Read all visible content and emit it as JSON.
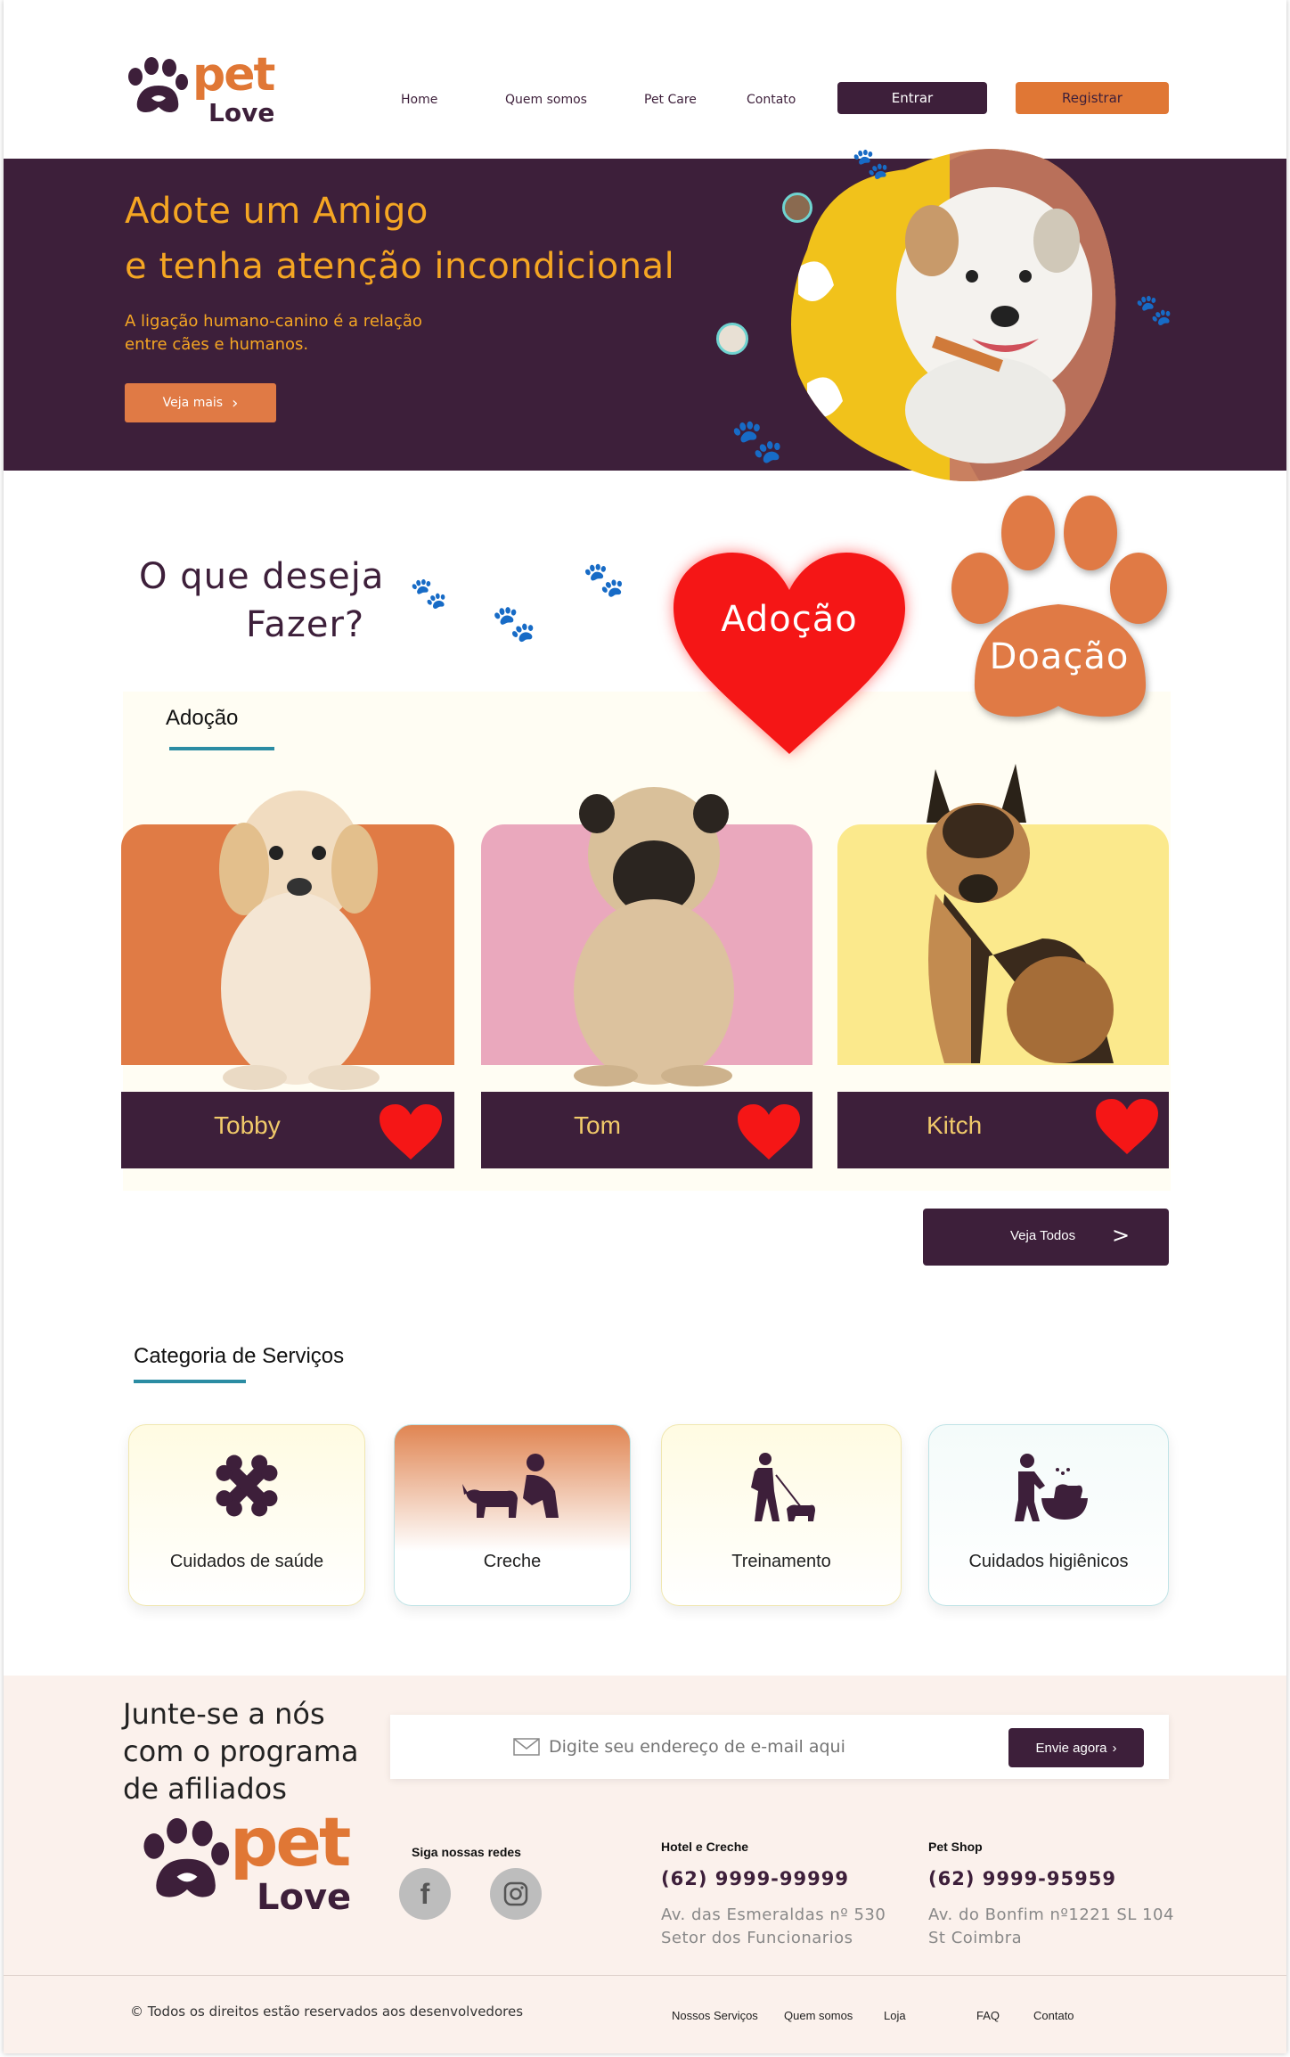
{
  "brand": {
    "pet": "pet",
    "love": "Love"
  },
  "nav": {
    "home": "Home",
    "quem_somos": "Quem somos",
    "pet_care": "Pet Care",
    "contato": "Contato",
    "entrar": "Entrar",
    "registrar": "Registrar"
  },
  "hero": {
    "title_line1": "Adote um Amigo",
    "title_line2": "e tenha atenção incondicional",
    "subtitle_line1": "A ligação humano-canino é a relação",
    "subtitle_line2": "entre cães e humanos.",
    "cta": "Veja mais"
  },
  "choice": {
    "question_line1": "O que deseja",
    "question_line2": "Fazer?",
    "adocao": "Adoção",
    "doacao": "Doação"
  },
  "adoption": {
    "heading": "Adoção",
    "pets": [
      {
        "name": "Tobby",
        "color": "#e07b45"
      },
      {
        "name": "Tom",
        "color": "#eaa8bd"
      },
      {
        "name": "Kitch",
        "color": "#fbe98c"
      }
    ],
    "see_all": "Veja Todos"
  },
  "services": {
    "heading": "Categoria de Serviços",
    "items": [
      {
        "label": "Cuidados de saúde",
        "icon": "bone-icon"
      },
      {
        "label": "Creche",
        "icon": "person-with-dog-icon"
      },
      {
        "label": "Treinamento",
        "icon": "dog-walking-icon"
      },
      {
        "label": "Cuidados higiênicos",
        "icon": "dog-bath-icon"
      }
    ]
  },
  "affiliate": {
    "line1": "Junte-se a nós",
    "line2": "com o programa",
    "line3": "de afiliados",
    "email_placeholder": "Digite seu endereço de e-mail aqui",
    "submit": "Envie agora"
  },
  "footer": {
    "social_heading": "Siga nossas redes",
    "hotel": {
      "title": "Hotel e Creche",
      "phone": "(62) 9999-99999",
      "addr1": "Av. das Esmeraldas nº 530",
      "addr2": "Setor dos Funcionarios"
    },
    "shop": {
      "title": "Pet Shop",
      "phone": "(62) 9999-95959",
      "addr1": "Av. do Bonfim nº1221 SL 104",
      "addr2": "St Coimbra"
    },
    "copyright": "© Todos os direitos estão reservados aos desenvolvedores",
    "links": [
      "Nossos Serviços",
      "Quem somos",
      "Loja",
      "FAQ",
      "Contato"
    ]
  },
  "colors": {
    "purple": "#3d1f3a",
    "orange": "#e07735",
    "yellow": "#f5a623",
    "teal": "#2b8ca3"
  }
}
